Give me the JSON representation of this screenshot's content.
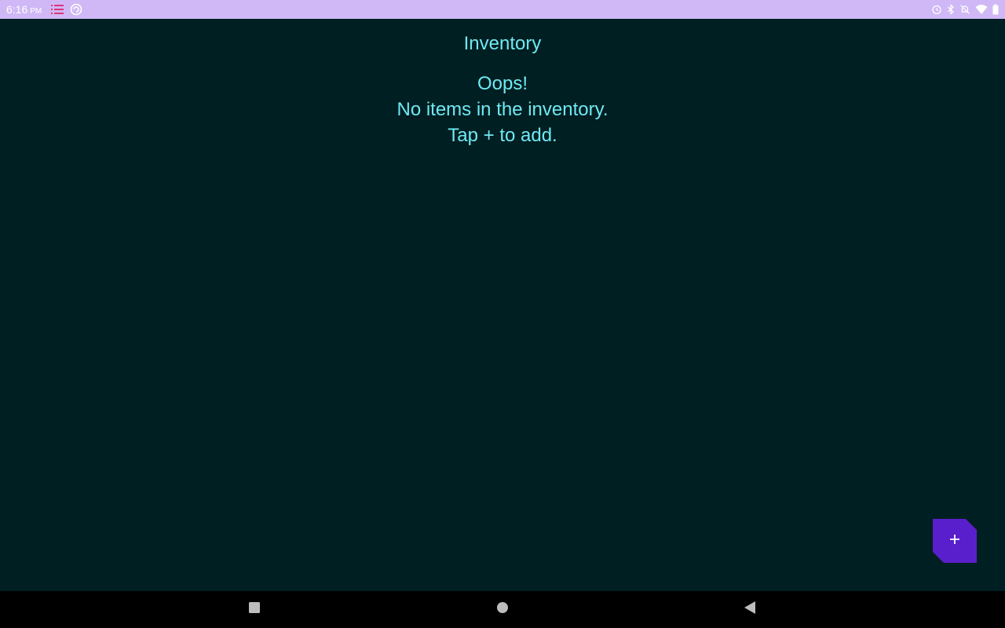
{
  "status_bar": {
    "time": "6:16",
    "ampm": "PM",
    "left_icons": [
      "list-icon",
      "sync-icon"
    ],
    "right_icons": [
      "alarm-icon",
      "bluetooth-icon",
      "notifications-off-icon",
      "wifi-icon",
      "battery-icon"
    ],
    "background": "#d0b8f6"
  },
  "app": {
    "title": "Inventory",
    "empty_state": {
      "line1": "Oops!",
      "line2": "No items in the inventory.",
      "line3": "Tap + to add."
    },
    "fab": {
      "icon": "plus-icon",
      "color": "#5a1fcc"
    },
    "background": "#001f22",
    "text_color": "#6fe9f2"
  },
  "nav_bar": {
    "buttons": [
      "recents-square-icon",
      "home-circle-icon",
      "back-triangle-icon"
    ]
  }
}
